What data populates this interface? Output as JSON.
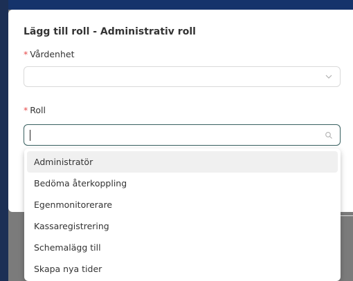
{
  "modal": {
    "title": "Lägg till roll - Administrativ roll"
  },
  "fields": {
    "vardenhet": {
      "required_mark": "*",
      "label": "Vårdenhet",
      "value": ""
    },
    "roll": {
      "required_mark": "*",
      "label": "Roll",
      "value": ""
    }
  },
  "dropdown": {
    "options": [
      "Administratör",
      "Bedöma återkoppling",
      "Egenmonitorerare",
      "Kassaregistrering",
      "Schemalägg till",
      "Skapa nya tider"
    ],
    "highlighted_index": 0
  },
  "icons": {
    "select_arrow": "chevron-down-icon",
    "search": "search-icon"
  },
  "colors": {
    "required": "#e64b4b",
    "focus_border": "#375f5f"
  }
}
